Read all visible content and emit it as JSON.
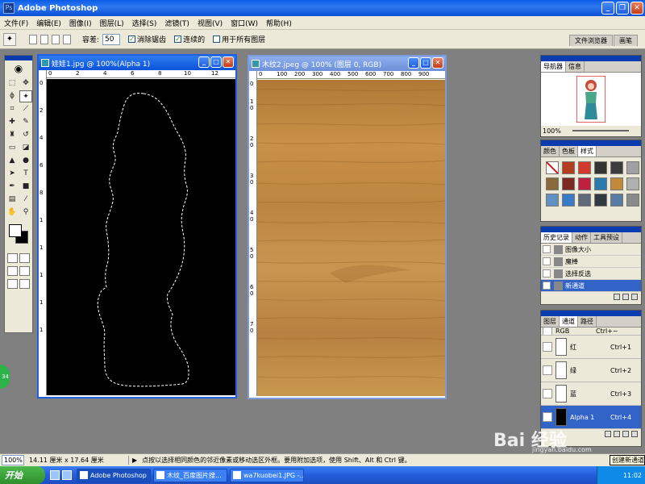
{
  "app": {
    "title": "Adobe Photoshop",
    "logo_glyph": "Ps"
  },
  "menu": [
    "文件(F)",
    "编辑(E)",
    "图像(I)",
    "图层(L)",
    "选择(S)",
    "滤镜(T)",
    "视图(V)",
    "窗口(W)",
    "帮助(H)"
  ],
  "options": {
    "tolerance_label": "容差:",
    "tolerance_value": "50",
    "antialias_label": "消除锯齿",
    "contiguous_label": "连续的",
    "all_layers_label": "用于所有图层",
    "palette_tabs": [
      "文件浏览器",
      "画笔"
    ]
  },
  "documents": {
    "doll": {
      "title": "娃娃1.jpg @ 100%(Alpha 1)",
      "ruler_h": [
        "0",
        "2",
        "4",
        "6",
        "8",
        "10",
        "12"
      ],
      "ruler_v": [
        "0",
        "2",
        "4",
        "6",
        "8",
        "1",
        "1",
        "1",
        "1",
        "1"
      ]
    },
    "wood": {
      "title": "木纹2.jpeg @ 100% (图层 0, RGB)",
      "ruler_h": [
        "0",
        "100",
        "200",
        "300",
        "400",
        "500",
        "600",
        "700",
        "800",
        "900"
      ],
      "ruler_v": [
        "0",
        "1",
        "0",
        "2",
        "0",
        "3",
        "0",
        "4",
        "0",
        "5",
        "0",
        "6",
        "0",
        "7",
        "0"
      ]
    }
  },
  "navigator": {
    "tabs": [
      "导航器",
      "信息"
    ],
    "zoom": "100%"
  },
  "swatches_panel": {
    "tabs": [
      "颜色",
      "色板",
      "样式"
    ],
    "styles": [
      "#ffffff",
      "#b33b1e",
      "#d23a2c",
      "#333333",
      "#3c3c3c",
      "#a0a0a0",
      "#8a6a3c",
      "#7a2a20",
      "#c02040",
      "#2a7ab0",
      "#c08a3a",
      "#b0b0b0",
      "#6090c0",
      "#3a78c8",
      "#606a78",
      "#303840",
      "#5a7aa0",
      "#8a8a8a"
    ]
  },
  "history": {
    "tabs": [
      "历史记录",
      "动作",
      "工具预设"
    ],
    "items": [
      "图像大小",
      "魔棒",
      "选择反选",
      "新通道"
    ]
  },
  "channels": {
    "tabs": [
      "图层",
      "通道",
      "路径"
    ],
    "top_partial": {
      "name": "RGB",
      "shortcut": "Ctrl+~"
    },
    "items": [
      {
        "name": "红",
        "shortcut": "Ctrl+1"
      },
      {
        "name": "绿",
        "shortcut": "Ctrl+2"
      },
      {
        "name": "蓝",
        "shortcut": "Ctrl+3"
      },
      {
        "name": "Alpha 1",
        "shortcut": "Ctrl+4"
      }
    ]
  },
  "status": {
    "zoom": "100%",
    "doc_size": "14.11 厘米 x 17.64 厘米",
    "hint": "点按以选择相同颜色的邻近像素或移动选区外框。要用附加选项，使用 Shift、Alt 和 Ctrl 键。"
  },
  "taskbar": {
    "start": "开始",
    "tasks": [
      "Adobe Photoshop",
      "木纹_百度图片搜...",
      "wa7kuobei1.JPG -..."
    ],
    "tray_time": "11:02",
    "tray_text": "创建新通道"
  },
  "badge": "34",
  "watermark": {
    "text": "Bai 经验",
    "url": "jingyan.baidu.com"
  }
}
